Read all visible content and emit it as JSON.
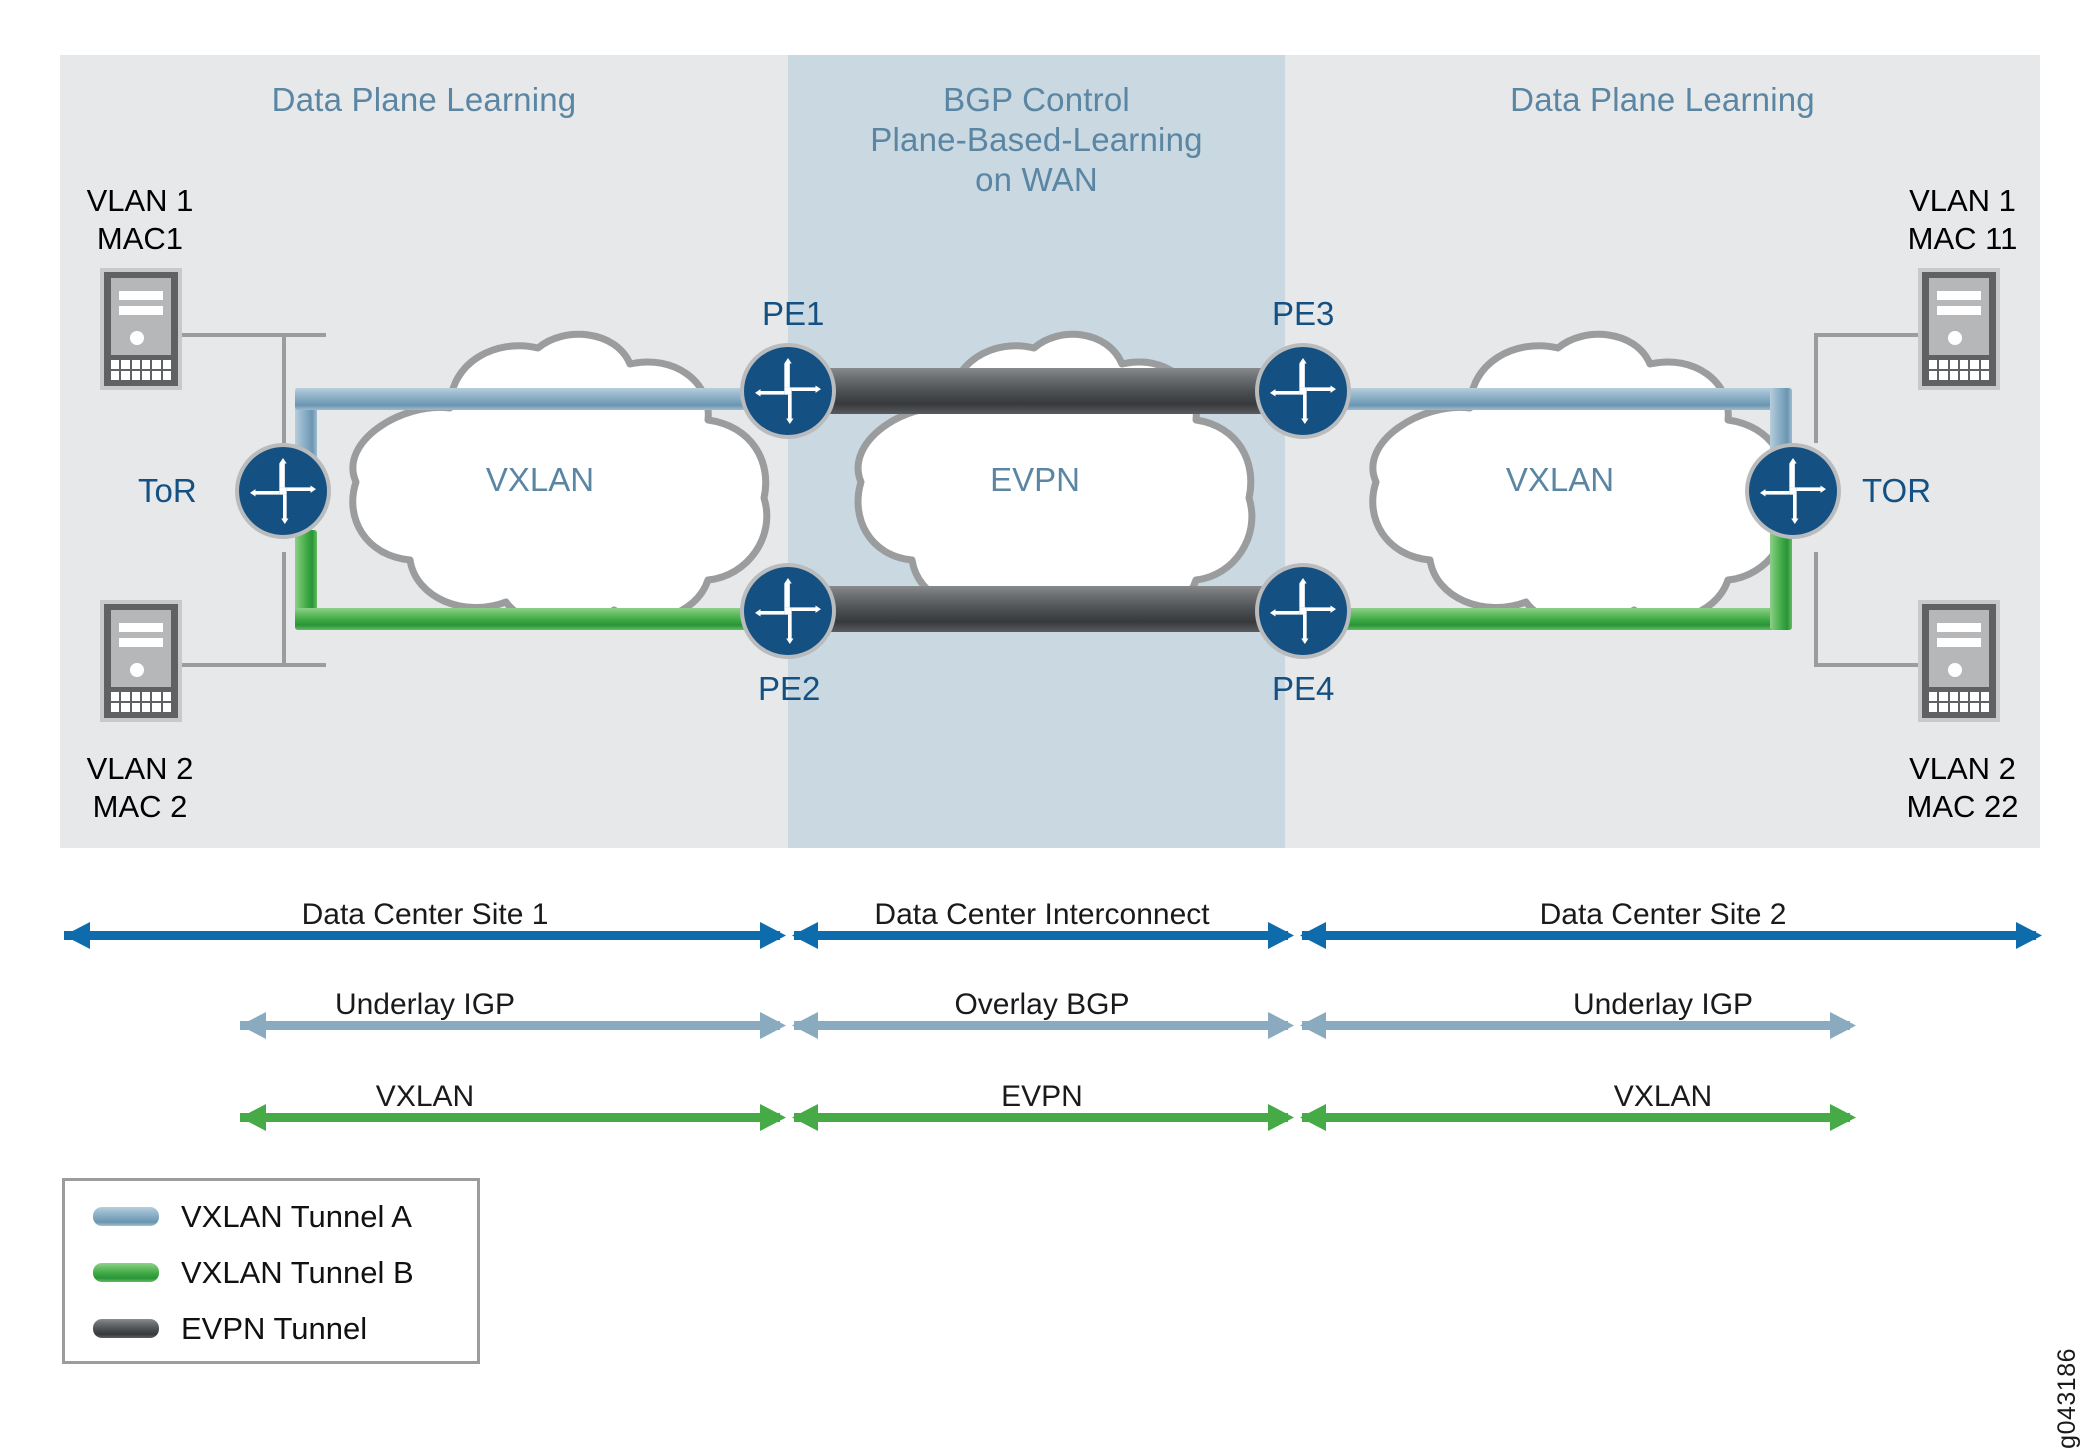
{
  "bands": {
    "left": {
      "title": "Data Plane Learning",
      "color": "#e6e8e9"
    },
    "mid": {
      "title": "BGP Control\nPlane-Based-Learning\non WAN",
      "color": "#c9d8e1"
    },
    "right": {
      "title": "Data Plane Learning",
      "color": "#e6e8e9"
    }
  },
  "endpoints": [
    {
      "id": "top-left",
      "label": "VLAN 1\nMAC1",
      "icon": "server-icon"
    },
    {
      "id": "bottom-left",
      "label": "VLAN 2\nMAC 2",
      "icon": "server-icon"
    },
    {
      "id": "top-right",
      "label": "VLAN 1\nMAC 11",
      "icon": "server-icon"
    },
    {
      "id": "bottom-right",
      "label": "VLAN 2\nMAC 22",
      "icon": "server-icon"
    }
  ],
  "routers": [
    {
      "id": "tor-left",
      "label": "ToR"
    },
    {
      "id": "pe1",
      "label": "PE1"
    },
    {
      "id": "pe2",
      "label": "PE2"
    },
    {
      "id": "pe3",
      "label": "PE3"
    },
    {
      "id": "pe4",
      "label": "PE4"
    },
    {
      "id": "tor-right",
      "label": "TOR"
    }
  ],
  "clouds": [
    {
      "id": "cloud-vxlan-left",
      "label": "VXLAN"
    },
    {
      "id": "cloud-evpn",
      "label": "EVPN"
    },
    {
      "id": "cloud-vxlan-right",
      "label": "VXLAN"
    }
  ],
  "scales": [
    {
      "id": "scale-sites",
      "color": "#0e6cad",
      "segments": [
        {
          "label": "Data Center Site 1"
        },
        {
          "label": "Data Center Interconnect"
        },
        {
          "label": "Data Center Site 2"
        }
      ]
    },
    {
      "id": "scale-protocol",
      "color": "#8aaabf",
      "segments": [
        {
          "label": "Underlay IGP"
        },
        {
          "label": "Overlay BGP"
        },
        {
          "label": "Underlay IGP"
        }
      ]
    },
    {
      "id": "scale-encap",
      "color": "#46ab47",
      "segments": [
        {
          "label": "VXLAN"
        },
        {
          "label": "EVPN"
        },
        {
          "label": "VXLAN"
        }
      ]
    }
  ],
  "legend": {
    "items": [
      {
        "label": "VXLAN Tunnel A",
        "color": "#7fa7c0",
        "swatch": "blue"
      },
      {
        "label": "VXLAN Tunnel B",
        "color": "#3ca943",
        "swatch": "green"
      },
      {
        "label": "EVPN Tunnel",
        "color": "#4c4f52",
        "swatch": "dark"
      }
    ]
  },
  "watermark": "g043186",
  "colors": {
    "router_fill": "#145182",
    "router_ring": "#b9bbbd",
    "cloud_stroke": "#9a9c9e",
    "text_blue": "#5b86a3",
    "label_blue": "#145182",
    "band_gray": "#e6e8e9",
    "band_blue": "#c9d8e1"
  }
}
